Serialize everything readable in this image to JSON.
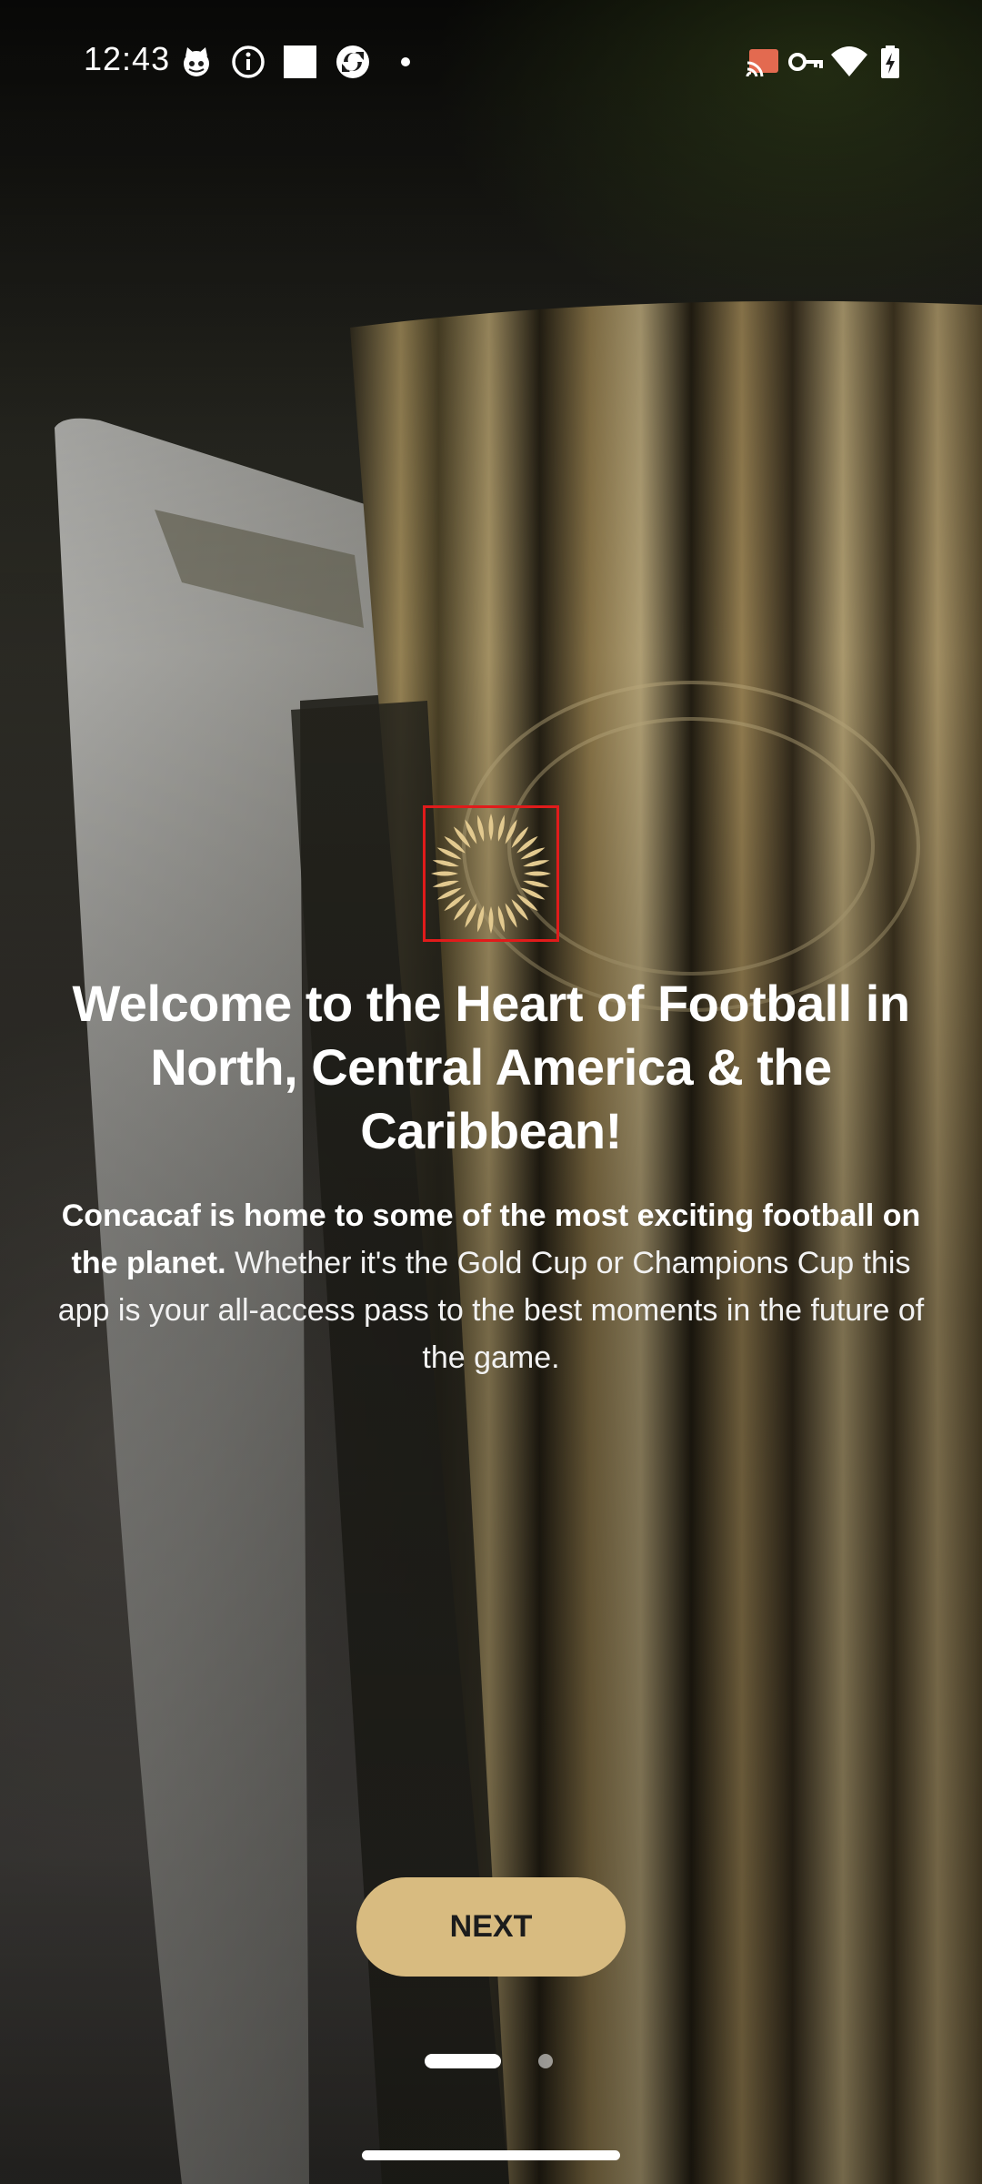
{
  "status_bar": {
    "time": "12:43",
    "left_icons": [
      "cat-face-icon",
      "info-icon",
      "square-icon",
      "sync-app-icon",
      "dot-icon"
    ],
    "right_icons": [
      "cast-icon",
      "vpn-key-icon",
      "wifi-icon",
      "battery-charging-icon"
    ]
  },
  "onboarding": {
    "title": "Welcome to the Heart of Football in North, Central America & the Caribbean!",
    "description_bold": "Concacaf is home to some of the most exciting football on the planet.",
    "description_rest": " Whether it's the Gold Cup or Champions Cup this app is your all-access pass to the best moments in the future of the game.",
    "logo_icon": "concacaf-sun-logo-icon",
    "next_label": "NEXT",
    "pages_total": 2,
    "current_page": 1
  },
  "colors": {
    "accent": "#d8bb80",
    "logo_gold": "#e2c98f",
    "highlight_frame": "#e11b1b",
    "text": "#ffffff"
  }
}
